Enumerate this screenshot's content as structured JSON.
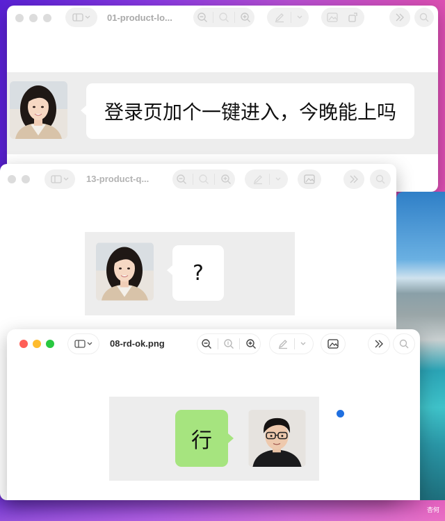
{
  "windows": [
    {
      "title": "01-product-lo...",
      "message": "登录页加个一键进入，今晚能上吗"
    },
    {
      "title": "13-product-q...",
      "message": "?"
    },
    {
      "title": "08-rd-ok.png",
      "message": "行"
    }
  ],
  "watermark": "杏何",
  "colors": {
    "close": "#ff5f57",
    "minimize": "#febc2e",
    "zoom": "#28c840",
    "reply_bubble": "#a6e47f",
    "chat_background": "#ededed",
    "status_dot": "#1f6fe0"
  },
  "icons": {
    "toolbar": [
      "sidebar-icon",
      "chevron-down-icon",
      "zoom-out-icon",
      "actual-size-icon",
      "zoom-in-icon",
      "markup-icon",
      "image-adjust-icon",
      "rotate-icon",
      "more-icon",
      "search-icon"
    ]
  }
}
